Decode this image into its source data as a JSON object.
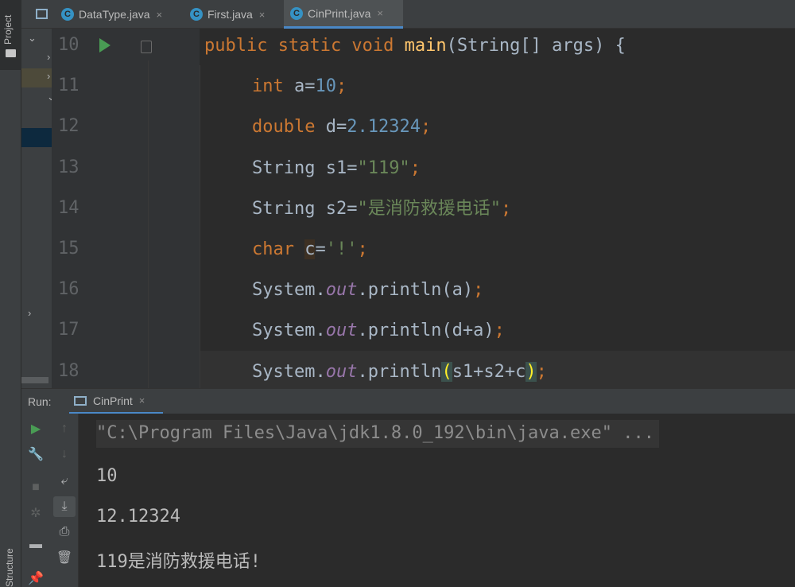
{
  "sidebar": {
    "project_label": "Project",
    "structure_label": "Structure"
  },
  "tabs": [
    {
      "label": "DataType.java",
      "icon": "C"
    },
    {
      "label": "First.java",
      "icon": "C"
    },
    {
      "label": "CinPrint.java",
      "icon": "C"
    }
  ],
  "close_glyph": "×",
  "editor": {
    "line_numbers": [
      "10",
      "11",
      "12",
      "13",
      "14",
      "15",
      "16",
      "17",
      "18"
    ],
    "lines": [
      [
        [
          "kw",
          "public static void "
        ],
        [
          "fn",
          "main"
        ],
        [
          "plain",
          "(String[] args) {"
        ]
      ],
      [
        [
          "kw",
          "int "
        ],
        [
          "plain",
          "a="
        ],
        [
          "num",
          "10"
        ],
        [
          "kw",
          ";"
        ]
      ],
      [
        [
          "kw",
          "double "
        ],
        [
          "plain",
          "d="
        ],
        [
          "num",
          "2.12324"
        ],
        [
          "kw",
          ";"
        ]
      ],
      [
        [
          "plain",
          "String s1="
        ],
        [
          "str",
          "\"119\""
        ],
        [
          "kw",
          ";"
        ]
      ],
      [
        [
          "plain",
          "String s2="
        ],
        [
          "str",
          "\"是消防救援电话\""
        ],
        [
          "kw",
          ";"
        ]
      ],
      [
        [
          "kw",
          "char "
        ],
        [
          "hlvar",
          "c"
        ],
        [
          "plain",
          "="
        ],
        [
          "str",
          "'!'"
        ],
        [
          "kw",
          ";"
        ]
      ],
      [
        [
          "plain",
          "System."
        ],
        [
          "field",
          "out"
        ],
        [
          "plain",
          ".println(a)"
        ],
        [
          "kw",
          ";"
        ]
      ],
      [
        [
          "plain",
          "System."
        ],
        [
          "field",
          "out"
        ],
        [
          "plain",
          ".println(d+a)"
        ],
        [
          "kw",
          ";"
        ]
      ],
      [
        [
          "plain",
          "System."
        ],
        [
          "field",
          "out"
        ],
        [
          "plain",
          ".println"
        ],
        [
          "paren",
          "("
        ],
        [
          "plain",
          "s1+s2+c"
        ],
        [
          "paren",
          ")"
        ],
        [
          "kw",
          ";"
        ]
      ]
    ]
  },
  "run_panel": {
    "label": "Run:",
    "tab_label": "CinPrint",
    "console": [
      "\"C:\\Program Files\\Java\\jdk1.8.0_192\\bin\\java.exe\" ...",
      "10",
      "12.12324",
      "119是消防救援电话!"
    ]
  }
}
